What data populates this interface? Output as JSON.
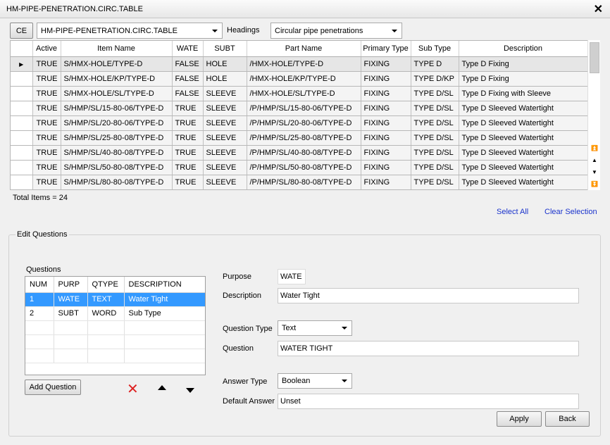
{
  "window": {
    "title": "HM-PIPE-PENETRATION.CIRC.TABLE"
  },
  "toolbar": {
    "ce_label": "CE",
    "table_select": "HM-PIPE-PENETRATION.CIRC.TABLE",
    "headings_label": "Headings",
    "headings_select": "Circular pipe penetrations"
  },
  "grid": {
    "columns": [
      "Active",
      "Item Name",
      "WATE",
      "SUBT",
      "Part Name",
      "Primary Type",
      "Sub Type",
      "Description"
    ],
    "rows": [
      [
        "TRUE",
        "S/HMX-HOLE/TYPE-D",
        "FALSE",
        "HOLE",
        "/HMX-HOLE/TYPE-D",
        "FIXING",
        "TYPE D",
        "Type D Fixing"
      ],
      [
        "TRUE",
        "S/HMX-HOLE/KP/TYPE-D",
        "FALSE",
        "HOLE",
        "/HMX-HOLE/KP/TYPE-D",
        "FIXING",
        "TYPE D/KP",
        "Type D Fixing"
      ],
      [
        "TRUE",
        "S/HMX-HOLE/SL/TYPE-D",
        "FALSE",
        "SLEEVE",
        "/HMX-HOLE/SL/TYPE-D",
        "FIXING",
        "TYPE D/SL",
        "Type D Fixing with Sleeve"
      ],
      [
        "TRUE",
        "S/HMP/SL/15-80-06/TYPE-D",
        "TRUE",
        "SLEEVE",
        "/P/HMP/SL/15-80-06/TYPE-D",
        "FIXING",
        "TYPE D/SL",
        "Type D Sleeved Watertight"
      ],
      [
        "TRUE",
        "S/HMP/SL/20-80-06/TYPE-D",
        "TRUE",
        "SLEEVE",
        "/P/HMP/SL/20-80-06/TYPE-D",
        "FIXING",
        "TYPE D/SL",
        "Type D Sleeved Watertight"
      ],
      [
        "TRUE",
        "S/HMP/SL/25-80-08/TYPE-D",
        "TRUE",
        "SLEEVE",
        "/P/HMP/SL/25-80-08/TYPE-D",
        "FIXING",
        "TYPE D/SL",
        "Type D Sleeved Watertight"
      ],
      [
        "TRUE",
        "S/HMP/SL/40-80-08/TYPE-D",
        "TRUE",
        "SLEEVE",
        "/P/HMP/SL/40-80-08/TYPE-D",
        "FIXING",
        "TYPE D/SL",
        "Type D Sleeved Watertight"
      ],
      [
        "TRUE",
        "S/HMP/SL/50-80-08/TYPE-D",
        "TRUE",
        "SLEEVE",
        "/P/HMP/SL/50-80-08/TYPE-D",
        "FIXING",
        "TYPE D/SL",
        "Type D Sleeved Watertight"
      ],
      [
        "TRUE",
        "S/HMP/SL/80-80-08/TYPE-D",
        "TRUE",
        "SLEEVE",
        "/P/HMP/SL/80-80-08/TYPE-D",
        "FIXING",
        "TYPE D/SL",
        "Type D Sleeved Watertight"
      ]
    ],
    "total_items": "Total Items = 24"
  },
  "selection": {
    "select_all": "Select All",
    "clear_selection": "Clear Selection"
  },
  "edit": {
    "group_label": "Edit Questions",
    "questions_label": "Questions",
    "q_columns": [
      "NUM",
      "PURP",
      "QTYPE",
      "DESCRIPTION"
    ],
    "q_rows": [
      [
        "1",
        "WATE",
        "TEXT",
        "Water Tight"
      ],
      [
        "2",
        "SUBT",
        "WORD",
        "Sub Type"
      ]
    ],
    "add_question": "Add Question",
    "purpose_label": "Purpose",
    "purpose_value": "WATE",
    "description_label": "Description",
    "description_value": "Water Tight",
    "question_type_label": "Question Type",
    "question_type_value": "Text",
    "question_label": "Question",
    "question_value": "WATER TIGHT",
    "answer_type_label": "Answer Type",
    "answer_type_value": "Boolean",
    "default_answer_label": "Default Answer",
    "default_answer_value": "Unset"
  },
  "buttons": {
    "apply": "Apply",
    "back": "Back"
  },
  "colors": {
    "selection_blue": "#3399ff",
    "delete_red": "#dd2222",
    "link_blue": "#1a33cc"
  }
}
